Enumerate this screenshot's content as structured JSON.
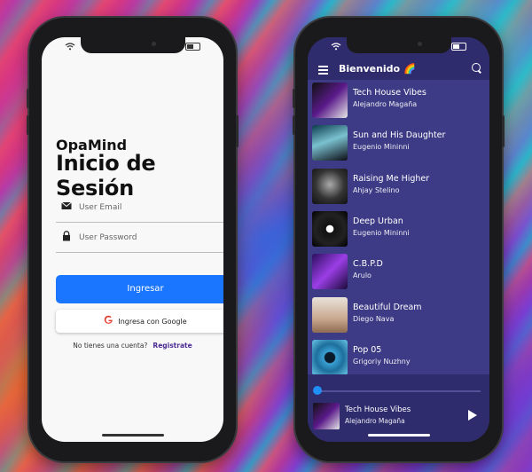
{
  "login": {
    "brand": "OpaMind",
    "title": "Inicio de Sesión",
    "email_placeholder": "User Email",
    "password_placeholder": "User Password",
    "submit_label": "Ingresar",
    "google_label": "Ingresa con Google",
    "signup_prompt": "No tienes una cuenta?",
    "signup_link": "Registrate"
  },
  "player_app": {
    "title": "Bienvenido 🌈",
    "tracks": [
      {
        "title": "Tech House Vibes",
        "artist": "Alejandro Magaña"
      },
      {
        "title": "Sun and His Daughter",
        "artist": "Eugenio Mininni"
      },
      {
        "title": "Raising Me Higher",
        "artist": "Ahjay Stelino"
      },
      {
        "title": "Deep Urban",
        "artist": "Eugenio Mininni"
      },
      {
        "title": "C.B.P.D",
        "artist": "Arulo"
      },
      {
        "title": "Beautiful Dream",
        "artist": "Diego Nava"
      },
      {
        "title": "Pop 05",
        "artist": "Grigoriy Nuzhny"
      }
    ],
    "now_playing": {
      "title": "Tech House Vibes",
      "artist": "Alejandro Magaña",
      "progress": 0.02
    }
  },
  "colors": {
    "primary": "#1a75ff",
    "link": "#4a2b93",
    "player_bg": "#3d3b85",
    "player_bar": "#2f2c6e"
  }
}
